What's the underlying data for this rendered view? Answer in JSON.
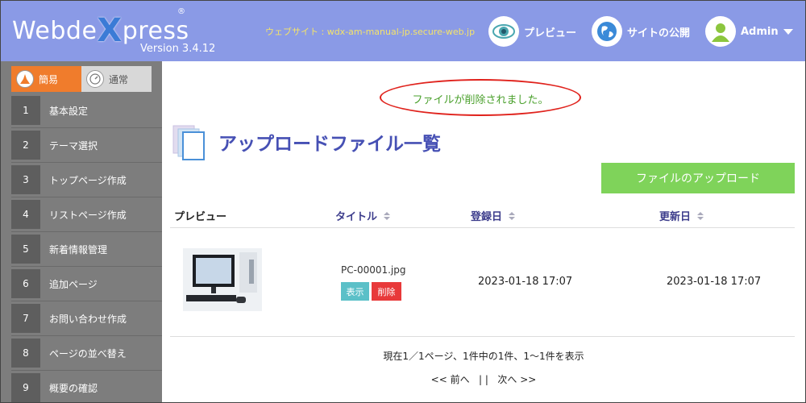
{
  "header": {
    "logo_pre": "Webde",
    "logo_x": "X",
    "logo_post": "press",
    "logo_reg": "®",
    "version": "Version 3.4.12",
    "site_label": "ウェブサイト : wdx-am-manual-jp.secure-web.jp",
    "preview_label": "プレビュー",
    "publish_label": "サイトの公開",
    "admin_label": "Admin"
  },
  "sidebar": {
    "mode_easy": "簡易",
    "mode_normal": "通常",
    "items": [
      {
        "num": "1",
        "label": "基本設定"
      },
      {
        "num": "2",
        "label": "テーマ選択"
      },
      {
        "num": "3",
        "label": "トップページ作成"
      },
      {
        "num": "4",
        "label": "リストページ作成"
      },
      {
        "num": "5",
        "label": "新着情報管理"
      },
      {
        "num": "6",
        "label": "追加ページ"
      },
      {
        "num": "7",
        "label": "お問い合わせ作成"
      },
      {
        "num": "8",
        "label": "ページの並べ替え"
      },
      {
        "num": "9",
        "label": "概要の確認"
      }
    ]
  },
  "main": {
    "message": "ファイルが削除されました。",
    "title": "アップロードファイル一覧",
    "upload_button": "ファイルのアップロード",
    "columns": {
      "preview": "プレビュー",
      "title": "タイトル",
      "created": "登録日",
      "updated": "更新日"
    },
    "rows": [
      {
        "filename": "PC-00001.jpg",
        "view_label": "表示",
        "delete_label": "削除",
        "created": "2023-01-18 17:07",
        "updated": "2023-01-18 17:07"
      }
    ],
    "pager_info": "現在1／1ページ、1件中の1件、1～1件を表示",
    "pager_prev": "<< 前へ",
    "pager_sep": "| |",
    "pager_next": "次へ >>"
  },
  "colors": {
    "header_bg": "#8a9ae6",
    "sidebar_bg": "#7d7d7d",
    "mode_active": "#f07c2c",
    "upload_btn": "#7fd35a",
    "title": "#4650b4",
    "message": "#4aa02c",
    "delete": "#e8393a",
    "view": "#5bc0c8"
  }
}
